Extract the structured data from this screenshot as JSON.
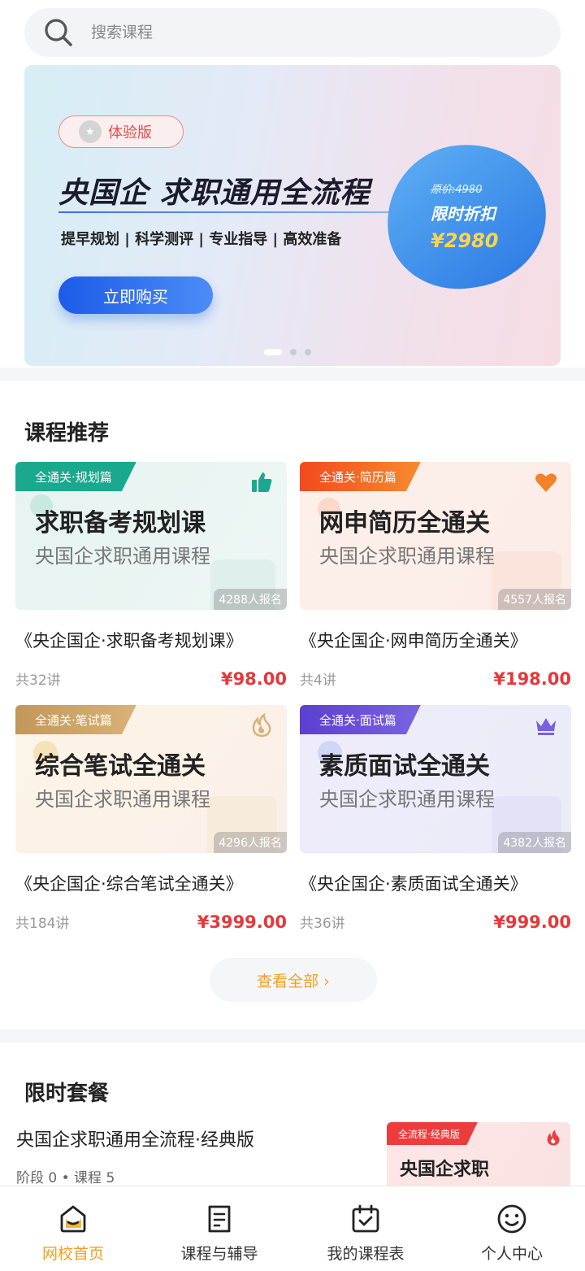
{
  "search": {
    "placeholder": "搜索课程"
  },
  "banner": {
    "badge": "体验版",
    "title": "央国企 求职通用全流程",
    "subtitle": "提早规划 | 科学测评 | 专业指导 | 高效准备",
    "buy_label": "立即购买",
    "original_price": "原价:4980",
    "promo_label": "限时折扣",
    "promo_price": "¥2980",
    "slides": 3,
    "active_slide": 1
  },
  "courses": {
    "title": "课程推荐",
    "items": [
      {
        "ribbon": "全通关·规划篇",
        "ribbon_color": "#1aa88e",
        "icon": "thumbs-up-icon",
        "icon_color": "#1aa88e",
        "big": "求职备考规划课",
        "small": "央国企求职通用课程",
        "enroll": "4288人报名",
        "name": "《央企国企·求职备考规划课》",
        "lessons": "共32讲",
        "price": "¥98.00"
      },
      {
        "ribbon": "全通关·简历篇",
        "ribbon_color": "#f35a22",
        "icon": "heart-icon",
        "icon_color": "#f3822a",
        "big": "网申简历全通关",
        "small": "央国企求职通用课程",
        "enroll": "4557人报名",
        "name": "《央企国企·网申简历全通关》",
        "lessons": "共4讲",
        "price": "¥198.00"
      },
      {
        "ribbon": "全通关·笔试篇",
        "ribbon_color": "#c9a064",
        "icon": "fire-icon",
        "icon_color": "#d9b07a",
        "big": "综合笔试全通关",
        "small": "央国企求职通用课程",
        "enroll": "4296人报名",
        "name": "《央企国企·综合笔试全通关》",
        "lessons": "共184讲",
        "price": "¥3999.00"
      },
      {
        "ribbon": "全通关·面试篇",
        "ribbon_color": "#6a4fd8",
        "icon": "crown-icon",
        "icon_color": "#7a5fe0",
        "big": "素质面试全通关",
        "small": "央国企求职通用课程",
        "enroll": "4382人报名",
        "name": "《央企国企·素质面试全通关》",
        "lessons": "共36讲",
        "price": "¥999.00"
      }
    ],
    "view_all": "查看全部 ›"
  },
  "packages": {
    "title": "限时套餐",
    "item": {
      "name": "央国企求职通用全流程·经典版",
      "meta": "阶段 0 • 课程 5",
      "thumb_ribbon": "全流程·经典版",
      "thumb_title": "央国企求职"
    }
  },
  "tabbar": [
    {
      "label": "网校首页",
      "icon": "home-icon",
      "active": true
    },
    {
      "label": "课程与辅导",
      "icon": "document-icon",
      "active": false
    },
    {
      "label": "我的课程表",
      "icon": "calendar-icon",
      "active": false
    },
    {
      "label": "个人中心",
      "icon": "smiley-icon",
      "active": false
    }
  ],
  "colors": {
    "accent": "#f0a023",
    "price": "#e5383b",
    "buy_button": "#1c5be8"
  }
}
